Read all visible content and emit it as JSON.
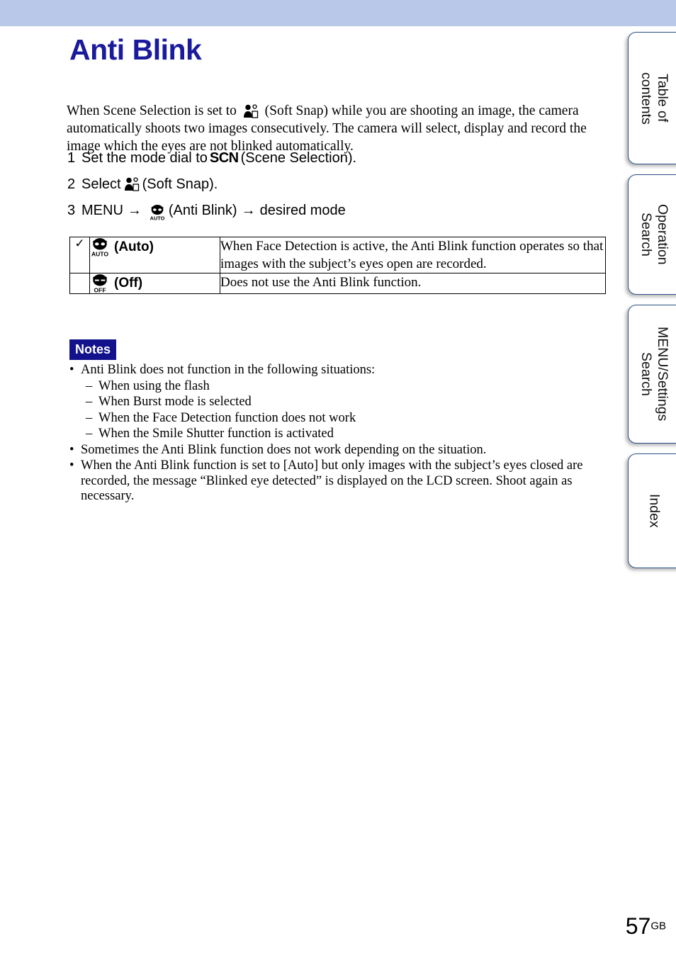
{
  "document": {
    "title": "Anti Blink",
    "page_number": "57",
    "page_number_suffix": "GB"
  },
  "intro": {
    "part1": "When Scene Selection is set to ",
    "icon1": "soft-snap-icon",
    "part2": " (Soft Snap) while you are shooting an image, the camera automatically shoots two images consecutively. The camera will select, display and record the image which the eyes are not blinked automatically."
  },
  "steps": [
    {
      "number": "1",
      "text_before": "Set the mode dial to ",
      "glyph": "SCN",
      "text_after": " (Scene Selection)."
    },
    {
      "number": "2",
      "text_before": "Select ",
      "icon": "soft-snap-icon",
      "text_after": " (Soft Snap)."
    },
    {
      "number": "3",
      "text_before": "MENU ",
      "arrow1": "→",
      "icon": "anti-blink-auto-icon",
      "text_middle": " (Anti Blink) ",
      "arrow2": "→",
      "text_after": " desired mode"
    }
  ],
  "options_table": {
    "rows": [
      {
        "checked": true,
        "check_mark": "✓",
        "icon": "anti-blink-auto-icon",
        "label": "(Auto)",
        "description": "When Face Detection is active, the Anti Blink function operates so that images with the subject’s eyes open are recorded."
      },
      {
        "checked": false,
        "check_mark": "",
        "icon": "anti-blink-off-icon",
        "label": "(Off)",
        "description": "Does not use the Anti Blink function."
      }
    ]
  },
  "notes": {
    "badge": "Notes",
    "items": [
      {
        "bullet": "•",
        "text": "Anti Blink does not function in the following situations:",
        "sub_items": [
          {
            "dash": "–",
            "text": "When using the flash"
          },
          {
            "dash": "–",
            "text": "When Burst mode is selected"
          },
          {
            "dash": "–",
            "text": "When the Face Detection function does not work"
          },
          {
            "dash": "–",
            "text": "When the Smile Shutter function is activated"
          }
        ]
      },
      {
        "bullet": "•",
        "text": "Sometimes the Anti Blink function does not work depending on the situation.",
        "sub_items": []
      },
      {
        "bullet": "•",
        "text": "When the Anti Blink function is set to [Auto] but only images with the subject’s eyes closed are recorded, the message “Blinked eye detected” is displayed on the LCD screen. Shoot again as necessary.",
        "sub_items": []
      }
    ]
  },
  "sidebar": {
    "tabs": [
      {
        "label": "Table of\ncontents"
      },
      {
        "label": "Operation\nSearch"
      },
      {
        "label": "MENU/Settings\nSearch"
      },
      {
        "label": "Index"
      }
    ]
  },
  "colors": {
    "header_band": "#b9c7e8",
    "title_blue": "#1a1a9c",
    "notes_badge_bg": "#11128c",
    "tab_border": "#2b5288"
  }
}
